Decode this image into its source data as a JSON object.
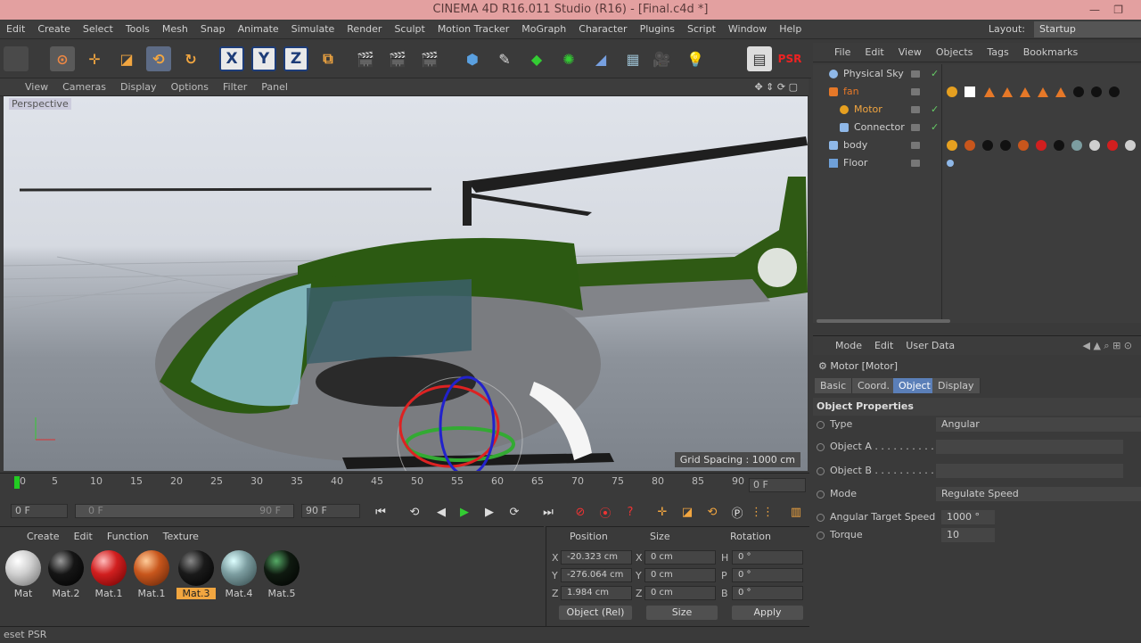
{
  "window": {
    "title": "CINEMA 4D R16.011 Studio (R16) - [Final.c4d *]"
  },
  "menubar": {
    "items": [
      "Edit",
      "Create",
      "Select",
      "Tools",
      "Mesh",
      "Snap",
      "Animate",
      "Simulate",
      "Render",
      "Sculpt",
      "Motion Tracker",
      "MoGraph",
      "Character",
      "Plugins",
      "Script",
      "Window",
      "Help"
    ],
    "layout_label": "Layout:",
    "layout_value": "Startup"
  },
  "toolbar": {
    "axis_x": "X",
    "axis_y": "Y",
    "axis_z": "Z",
    "psr": "PSR"
  },
  "viewport": {
    "menu": [
      "View",
      "Cameras",
      "Display",
      "Options",
      "Filter",
      "Panel"
    ],
    "label": "Perspective",
    "grid_spacing": "Grid Spacing : 1000 cm"
  },
  "timeline": {
    "ticks": [
      "0",
      "5",
      "10",
      "15",
      "20",
      "25",
      "30",
      "35",
      "40",
      "45",
      "50",
      "55",
      "60",
      "65",
      "70",
      "75",
      "80",
      "85",
      "90"
    ],
    "current_frame": "0 F",
    "start": "0 F",
    "range_start": "0 F",
    "range_end": "90 F",
    "end": "90 F"
  },
  "materials": {
    "menu": [
      "Create",
      "Edit",
      "Function",
      "Texture"
    ],
    "items": [
      {
        "name": "Mat",
        "color": "#cfcfcf"
      },
      {
        "name": "Mat.2",
        "color": "#151515"
      },
      {
        "name": "Mat.1",
        "color": "#d11f1f"
      },
      {
        "name": "Mat.1",
        "color": "#c8561c"
      },
      {
        "name": "Mat.3",
        "color": "#1a1a1a",
        "selected": true
      },
      {
        "name": "Mat.4",
        "color": "#7c9da0"
      },
      {
        "name": "Mat.5",
        "color": "#0f1a10"
      }
    ]
  },
  "coords": {
    "headers": {
      "position": "Position",
      "size": "Size",
      "rotation": "Rotation"
    },
    "rows": [
      {
        "axis": "X",
        "pos": "-20.323 cm",
        "size_axis": "X",
        "size": "0 cm",
        "rot_axis": "H",
        "rot": "0 °"
      },
      {
        "axis": "Y",
        "pos": "-276.064 cm",
        "size_axis": "Y",
        "size": "0 cm",
        "rot_axis": "P",
        "rot": "0 °"
      },
      {
        "axis": "Z",
        "pos": "1.984 cm",
        "size_axis": "Z",
        "size": "0 cm",
        "rot_axis": "B",
        "rot": "0 °"
      }
    ],
    "mode": "Object (Rel)",
    "size_mode": "Size",
    "apply": "Apply"
  },
  "status": "eset PSR",
  "object_manager": {
    "menu": [
      "File",
      "Edit",
      "View",
      "Objects",
      "Tags",
      "Bookmarks"
    ],
    "objects": [
      {
        "name": "Physical Sky",
        "color": "#8fb8e8",
        "indent": 0
      },
      {
        "name": "fan",
        "color": "#e67828",
        "indent": 0
      },
      {
        "name": "Motor",
        "color": "#e6a020",
        "indent": 1
      },
      {
        "name": "Connector",
        "color": "#8fb8e8",
        "indent": 1
      },
      {
        "name": "body",
        "color": "#8fb8e8",
        "indent": 0
      },
      {
        "name": "Floor",
        "color": "#6fa0d8",
        "indent": 0
      }
    ]
  },
  "attributes": {
    "menu": [
      "Mode",
      "Edit",
      "User Data"
    ],
    "object_title": "Motor [Motor]",
    "tabs": [
      "Basic",
      "Coord.",
      "Object",
      "Display"
    ],
    "active_tab": "Object",
    "section": "Object Properties",
    "props": [
      {
        "label": "Type",
        "value": "Angular"
      },
      {
        "label": "Object A . . . . . . . . . . . .",
        "value": ""
      },
      {
        "label": "Object B . . . . . . . . . . . .",
        "value": ""
      },
      {
        "label": "Mode",
        "value": "Regulate Speed"
      },
      {
        "label": "Angular Target Speed",
        "value": "1000 °"
      },
      {
        "label": "Torque",
        "value": "10"
      }
    ]
  }
}
